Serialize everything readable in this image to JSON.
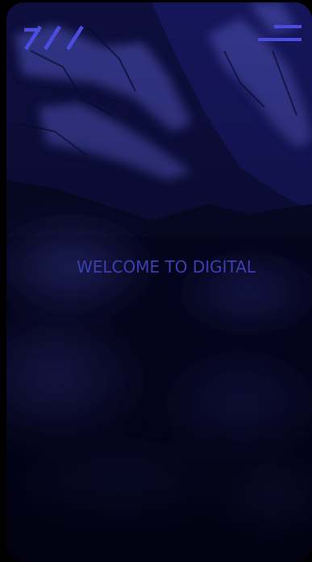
{
  "hero": {
    "heading": "WELCOME TO DIGITAL"
  },
  "header": {
    "logo_icon": "triple-slash-logo-icon",
    "menu_icon": "hamburger-menu-icon"
  },
  "theme": {
    "page_background": "#000000",
    "overlay": "#1c1d6e",
    "accent": "#4548d6",
    "heading_color": "#3d3fae"
  }
}
